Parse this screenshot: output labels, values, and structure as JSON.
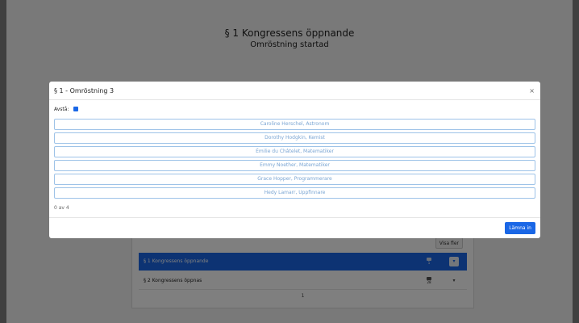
{
  "background": {
    "title": "§ 1 Kongressens öppnande",
    "subtitle": "Omröstning startad",
    "show_more_label": "Visa fler",
    "agenda": [
      {
        "label": "§ 1 Kongressens öppnande",
        "icon_count": "1",
        "toggle": "▾"
      },
      {
        "label": "§ 2 Kongressens öppnas",
        "icon_count": "28",
        "toggle": "▾"
      }
    ],
    "page_number": "1"
  },
  "modal": {
    "title": "§ 1 - Omröstning 3",
    "close_label": "×",
    "abstain_label": "Avstå:",
    "options": [
      "Caroline Herschel, Astronom",
      "Dorothy Hodgkin, Kemist",
      "Émilie du Châtelet, Matematiker",
      "Emmy Noether, Matematiker",
      "Grace Hopper, Programmerare",
      "Hedy Lamarr, Uppfinnare"
    ],
    "counter": "0 av 4",
    "submit_label": "Lämna in"
  },
  "colors": {
    "accent": "#1a67e6",
    "option_border": "#9ec3e8",
    "option_text": "#7aa5d3"
  }
}
